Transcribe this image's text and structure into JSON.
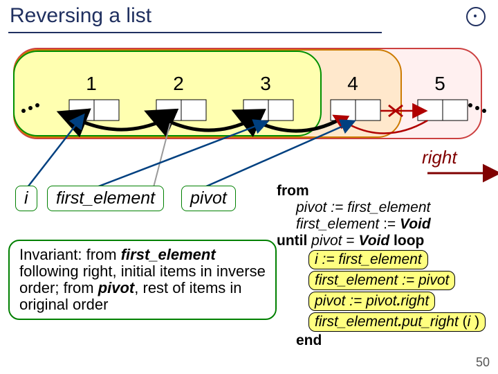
{
  "title": "Reversing a list",
  "nodes": [
    "1",
    "2",
    "3",
    "4",
    "5"
  ],
  "right_label": "right",
  "vars": {
    "i": "i",
    "first_element": "first_element",
    "pivot": "pivot"
  },
  "invariant": {
    "pre": "Invariant: from ",
    "fe": "first_element",
    "mid1": " following right, initial items in inverse order; from ",
    "pv": "pivot",
    "post": ", rest of items in original order"
  },
  "code": {
    "from": "from",
    "l1a": "pivot ",
    "l1b": ":= first_element",
    "l2a": "first_element ",
    "l2b": ":= ",
    "l2c": "Void",
    "until": "until ",
    "untilcond_a": "pivot ",
    "untilcond_b": "= ",
    "untilcond_c": "Void ",
    "loop": "loop",
    "b1a": "i ",
    "b1b": ":= first_element",
    "b2a": "first_element ",
    "b2b": ":= pivot",
    "b3a": "pivot ",
    "b3b": ":= pivot",
    "b3c": ".",
    "b3d": "right",
    "b4a": "first_element",
    "b4b": ".",
    "b4c": "put_right ",
    "b4d": "(",
    "b4e": "i ",
    "b4f": ")",
    "end": "end"
  },
  "page": "50"
}
